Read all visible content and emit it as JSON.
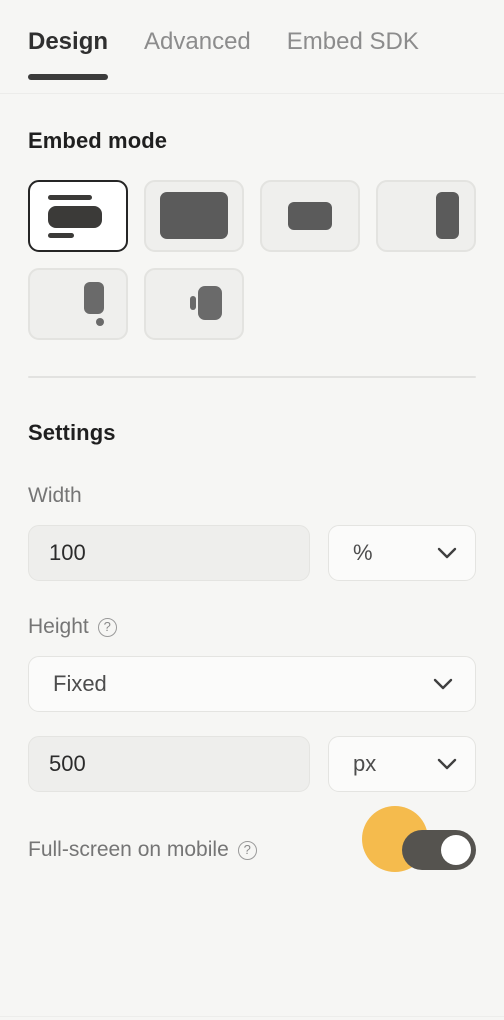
{
  "tabs": [
    {
      "label": "Design",
      "active": true
    },
    {
      "label": "Advanced",
      "active": false
    },
    {
      "label": "Embed SDK",
      "active": false
    }
  ],
  "embed_mode": {
    "title": "Embed mode",
    "options": [
      {
        "name": "inline",
        "selected": true
      },
      {
        "name": "full-screen",
        "selected": false
      },
      {
        "name": "modal",
        "selected": false
      },
      {
        "name": "slider",
        "selected": false
      },
      {
        "name": "popup",
        "selected": false
      },
      {
        "name": "side-tab",
        "selected": false
      }
    ]
  },
  "settings": {
    "title": "Settings",
    "width": {
      "label": "Width",
      "value": "100",
      "unit": "%"
    },
    "height": {
      "label": "Height",
      "help": "?",
      "mode": "Fixed",
      "value": "500",
      "unit": "px"
    },
    "fullscreen_mobile": {
      "label": "Full-screen on mobile",
      "help": "?",
      "enabled": true
    }
  },
  "colors": {
    "accent": "#f5b335",
    "toggle_on": "#55534f",
    "text_dark": "#1f1f1f",
    "text_muted": "#757575",
    "panel_bg": "#f6f6f4"
  }
}
